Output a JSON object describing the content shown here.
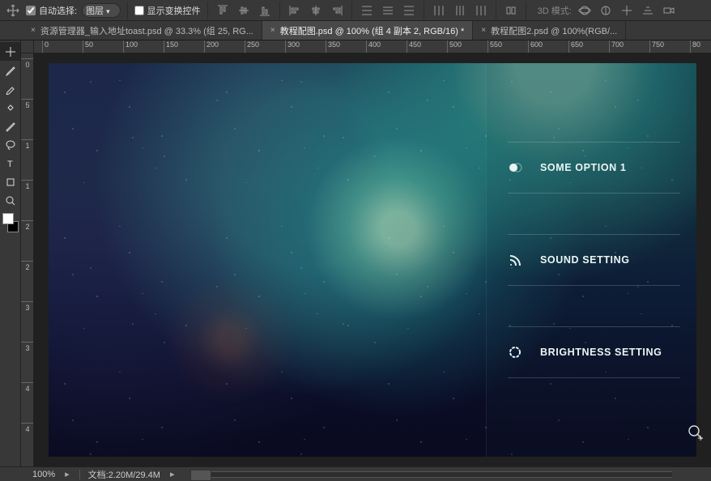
{
  "options_bar": {
    "auto_select": {
      "label": "自动选择:",
      "checked": true
    },
    "layer_select_value": "图层",
    "transform_controls": {
      "label": "显示变换控件",
      "checked": false
    },
    "mode_3d_label": "3D 模式:"
  },
  "tabs": [
    {
      "label": "资源管理器_输入地址toast.psd @ 33.3% (组 25, RG...",
      "active": false
    },
    {
      "label": "教程配图.psd @ 100% (组 4 副本 2, RGB/16) *",
      "active": true
    },
    {
      "label": "教程配图2.psd @ 100%(RGB/...",
      "active": false
    }
  ],
  "ruler": {
    "h_values": [
      "0",
      "50",
      "100",
      "150",
      "200",
      "250",
      "300",
      "350",
      "400",
      "450",
      "500",
      "550",
      "600",
      "650",
      "700",
      "750",
      "80"
    ],
    "v_values": [
      "0",
      "5",
      "1",
      "1",
      "2",
      "2",
      "3",
      "3",
      "4",
      "4"
    ]
  },
  "overlay": {
    "items": [
      {
        "icon": "toggle-icon",
        "label": "SOME OPTION 1"
      },
      {
        "icon": "rss-icon",
        "label": "SOUND SETTING"
      },
      {
        "icon": "loading-icon",
        "label": "BRIGHTNESS SETTING"
      }
    ]
  },
  "status_bar": {
    "zoom": "100%",
    "doc_label": "文档:",
    "doc_info": "2.20M/29.4M"
  }
}
